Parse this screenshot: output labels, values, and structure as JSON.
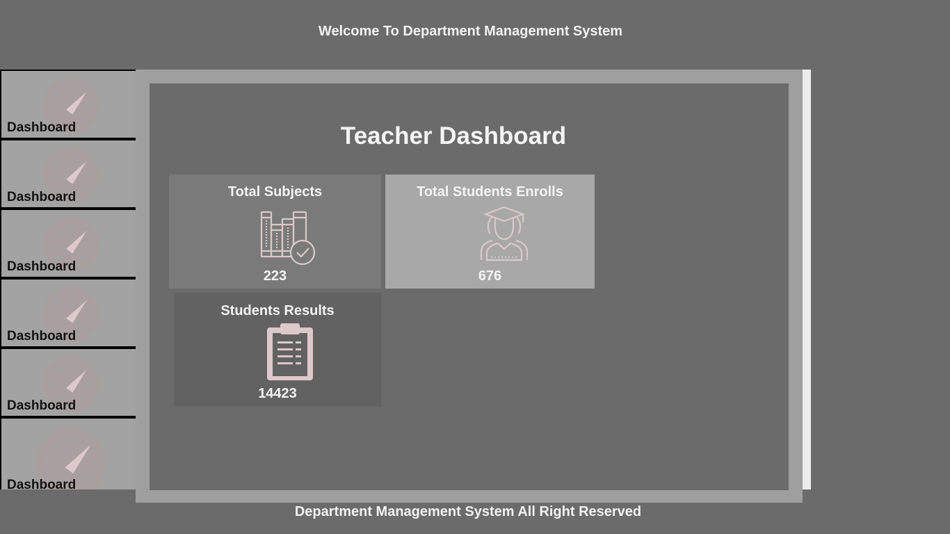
{
  "header": {
    "title": "Welcome To Department Management System"
  },
  "sidebar": {
    "items": [
      {
        "label": "Dashboard",
        "icon": "dashboard-gauge-icon"
      },
      {
        "label": "Dashboard",
        "icon": "dashboard-gauge-icon"
      },
      {
        "label": "Dashboard",
        "icon": "dashboard-gauge-icon"
      },
      {
        "label": "Dashboard",
        "icon": "dashboard-gauge-icon"
      },
      {
        "label": "Dashboard",
        "icon": "dashboard-gauge-icon"
      },
      {
        "label": "Dashboard",
        "icon": "dashboard-gauge-icon"
      }
    ]
  },
  "main": {
    "title": "Teacher Dashboard",
    "cards": [
      {
        "title": "Total Subjects",
        "value": "223",
        "icon": "books-check-icon",
        "background": "#7a7a7a"
      },
      {
        "title": "Total Students Enrolls",
        "value": "676",
        "icon": "graduate-students-icon",
        "background": "#a8a8a8"
      },
      {
        "title": "Students Results",
        "value": "14423",
        "icon": "clipboard-icon",
        "background": "#626262"
      }
    ]
  },
  "footer": {
    "text": "Department Management System All Right Reserved"
  },
  "colors": {
    "background": "#6b6b6b",
    "frame": "#9f9f9f",
    "sidebar_item": "#a3a3a3",
    "icon_tint": "#dcc9c9",
    "text_light": "#f4f4f4",
    "text_dark": "#111111"
  }
}
